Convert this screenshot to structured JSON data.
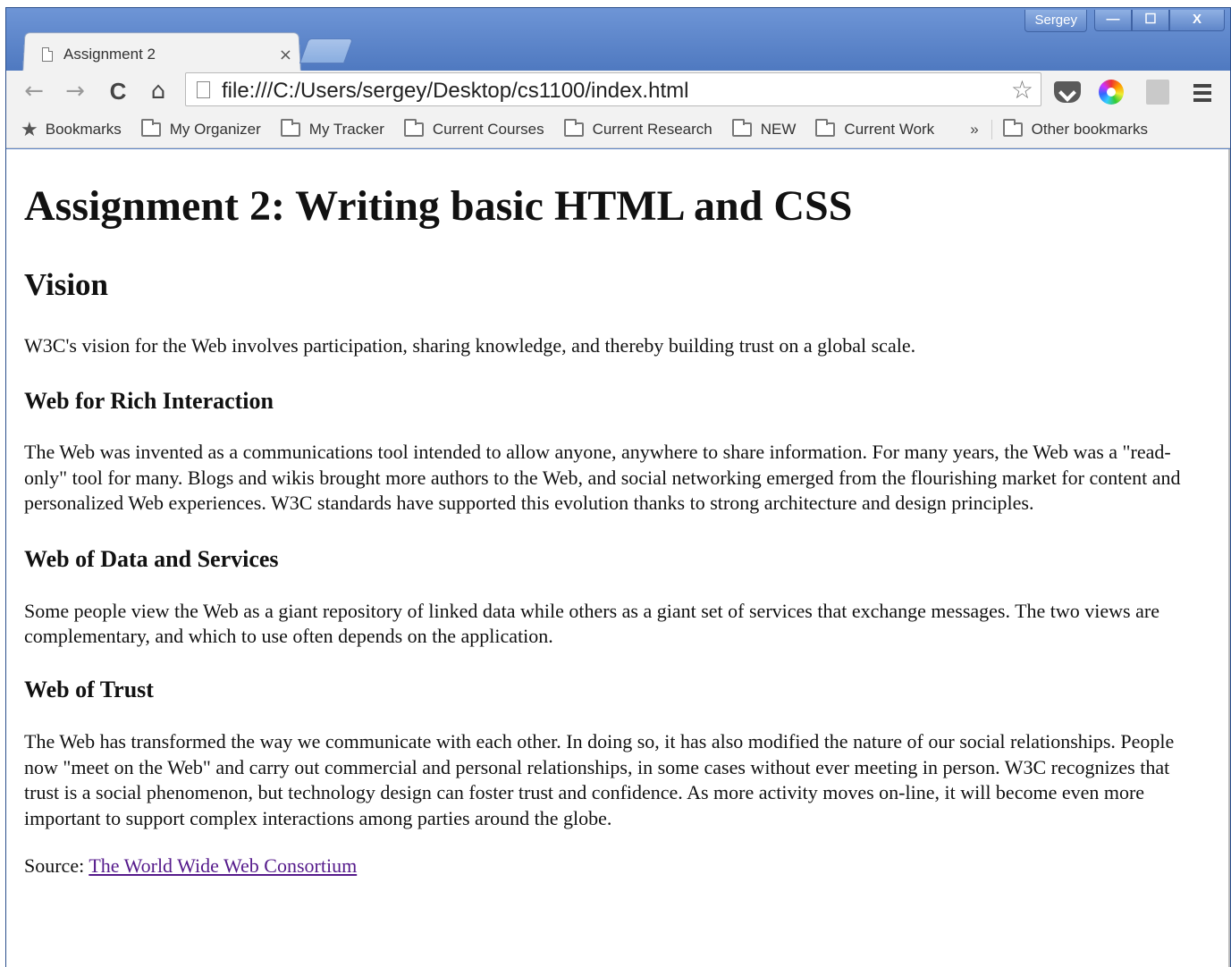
{
  "window": {
    "user": "Sergey",
    "controls": {
      "minimize": "—",
      "maximize": "☐",
      "close": "X"
    }
  },
  "tab": {
    "title": "Assignment 2",
    "close": "×"
  },
  "toolbar": {
    "back": "←",
    "forward": "→",
    "reload": "C",
    "home": "⌂",
    "url": "file:///C:/Users/sergey/Desktop/cs1100/index.html",
    "star": "☆"
  },
  "bookmarks": {
    "label": "Bookmarks",
    "items": [
      "My Organizer",
      "My Tracker",
      "Current Courses",
      "Current Research",
      "NEW",
      "Current Work"
    ],
    "overflow": "»",
    "other": "Other bookmarks"
  },
  "page": {
    "h1": "Assignment 2: Writing basic HTML and CSS",
    "vision_heading": "Vision",
    "vision_text": "W3C's vision for the Web involves participation, sharing knowledge, and thereby building trust on a global scale.",
    "s1_heading": "Web for Rich Interaction",
    "s1_text": "The Web was invented as a communications tool intended to allow anyone, anywhere to share information. For many years, the Web was a \"read-only\" tool for many. Blogs and wikis brought more authors to the Web, and social networking emerged from the flourishing market for content and personalized Web experiences. W3C standards have supported this evolution thanks to strong architecture and design principles.",
    "s2_heading": "Web of Data and Services",
    "s2_text": "Some people view the Web as a giant repository of linked data while others as a giant set of services that exchange messages. The two views are complementary, and which to use often depends on the application.",
    "s3_heading": "Web of Trust",
    "s3_text": "The Web has transformed the way we communicate with each other. In doing so, it has also modified the nature of our social relationships. People now \"meet on the Web\" and carry out commercial and personal relationships, in some cases without ever meeting in person. W3C recognizes that trust is a social phenomenon, but technology design can foster trust and confidence. As more activity moves on-line, it will become even more important to support complex interactions among parties around the globe.",
    "source_label": "Source: ",
    "source_link": "The World Wide Web Consortium"
  }
}
